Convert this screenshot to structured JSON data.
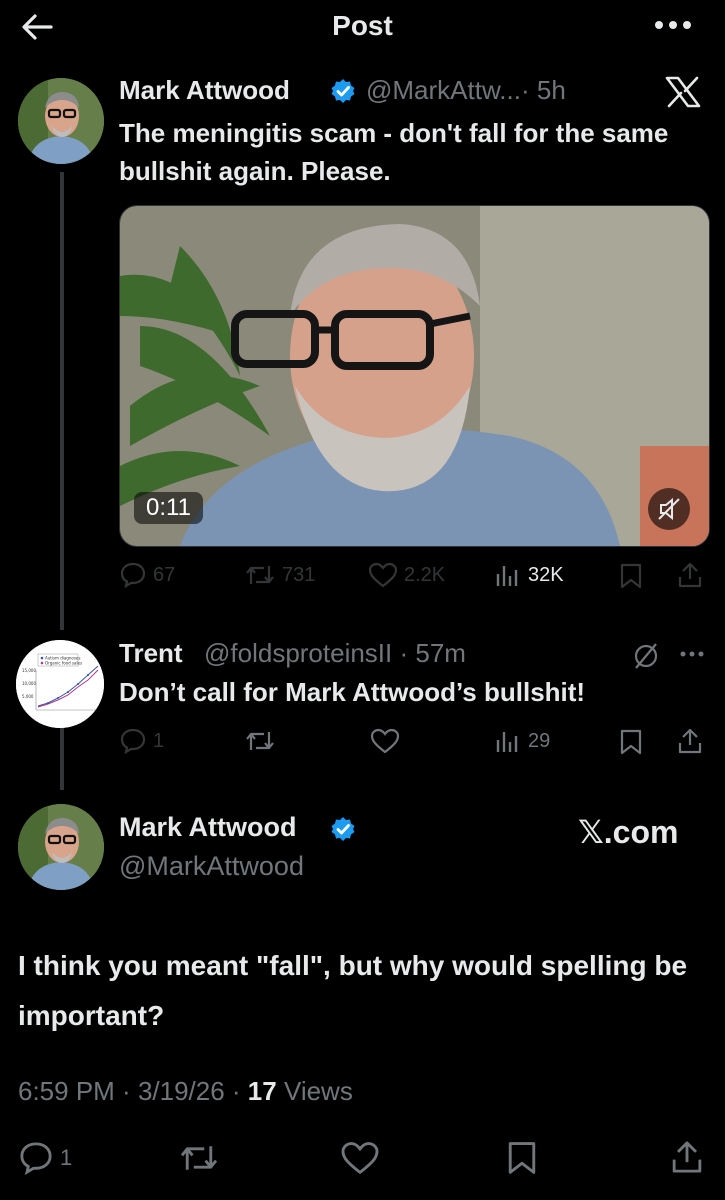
{
  "header": {
    "title": "Post",
    "back_icon": "arrow-left-icon",
    "more_icon": "more-horizontal-icon"
  },
  "tweet1": {
    "name": "Mark Attwood",
    "handle": "@MarkAttw...",
    "time": "· 5h",
    "text": "The meningitis scam - don't fall for the same bullshit again. Please.",
    "video_duration": "0:11",
    "replies": "67",
    "reposts": "731",
    "likes": "2.2K",
    "views": "32K"
  },
  "tweet2": {
    "name": "Trent",
    "handle": "@foldsproteinsII",
    "time": "· 57m",
    "text": "Don’t call for Mark Attwood’s bullshit!",
    "avatar_legend": [
      "Autism diagnoses",
      "Organic food sales"
    ],
    "avatar_ticks": [
      "15,000",
      "10,000",
      "5,000"
    ],
    "replies": "1",
    "views": "29"
  },
  "tweet3": {
    "name": "Mark Attwood",
    "handle": "@MarkAttwood",
    "source": "𝕏.com",
    "text": "I think you meant \"fall\", but why would spelling be important?",
    "time": "6:59 PM",
    "date": "3/19/26",
    "views_count": "17",
    "views_label": "Views",
    "replies": "1"
  },
  "colors": {
    "background": "#000000",
    "text": "#e7e9ea",
    "muted": "#71767b",
    "verified": "#1d9bf0"
  }
}
